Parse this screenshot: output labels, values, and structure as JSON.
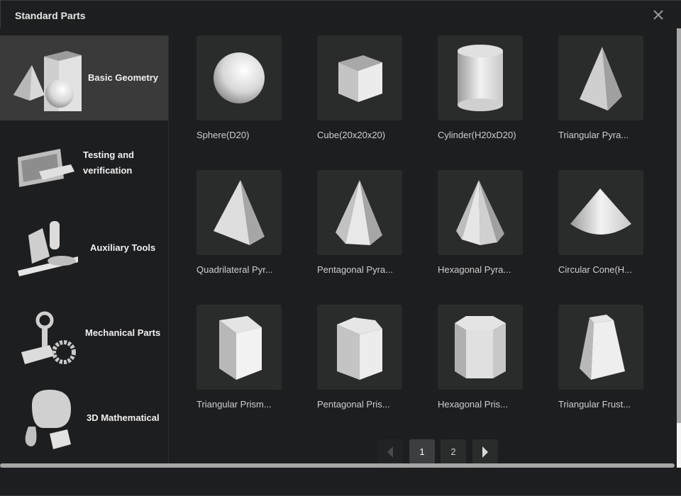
{
  "window": {
    "title": "Standard Parts",
    "close_icon": "close-icon"
  },
  "sidebar": {
    "items": [
      {
        "label": "Basic Geometry",
        "active": true
      },
      {
        "label": "Testing and verification",
        "line1": "Testing and",
        "line2": "verification"
      },
      {
        "label": "Auxiliary Tools"
      },
      {
        "label": "Mechanical Parts"
      },
      {
        "label": "3D Mathematical"
      }
    ]
  },
  "parts": [
    {
      "name": "Sphere(D20)"
    },
    {
      "name": "Cube(20x20x20)"
    },
    {
      "name": "Cylinder(H20xD20)"
    },
    {
      "name": "Triangular Pyra..."
    },
    {
      "name": "Quadrilateral Pyr..."
    },
    {
      "name": "Pentagonal Pyra..."
    },
    {
      "name": "Hexagonal Pyra..."
    },
    {
      "name": "Circular Cone(H..."
    },
    {
      "name": "Triangular Prism..."
    },
    {
      "name": "Pentagonal Pris..."
    },
    {
      "name": "Hexagonal Pris..."
    },
    {
      "name": "Triangular Frust..."
    }
  ],
  "pagination": {
    "pages": [
      "1",
      "2"
    ],
    "current": "1"
  }
}
